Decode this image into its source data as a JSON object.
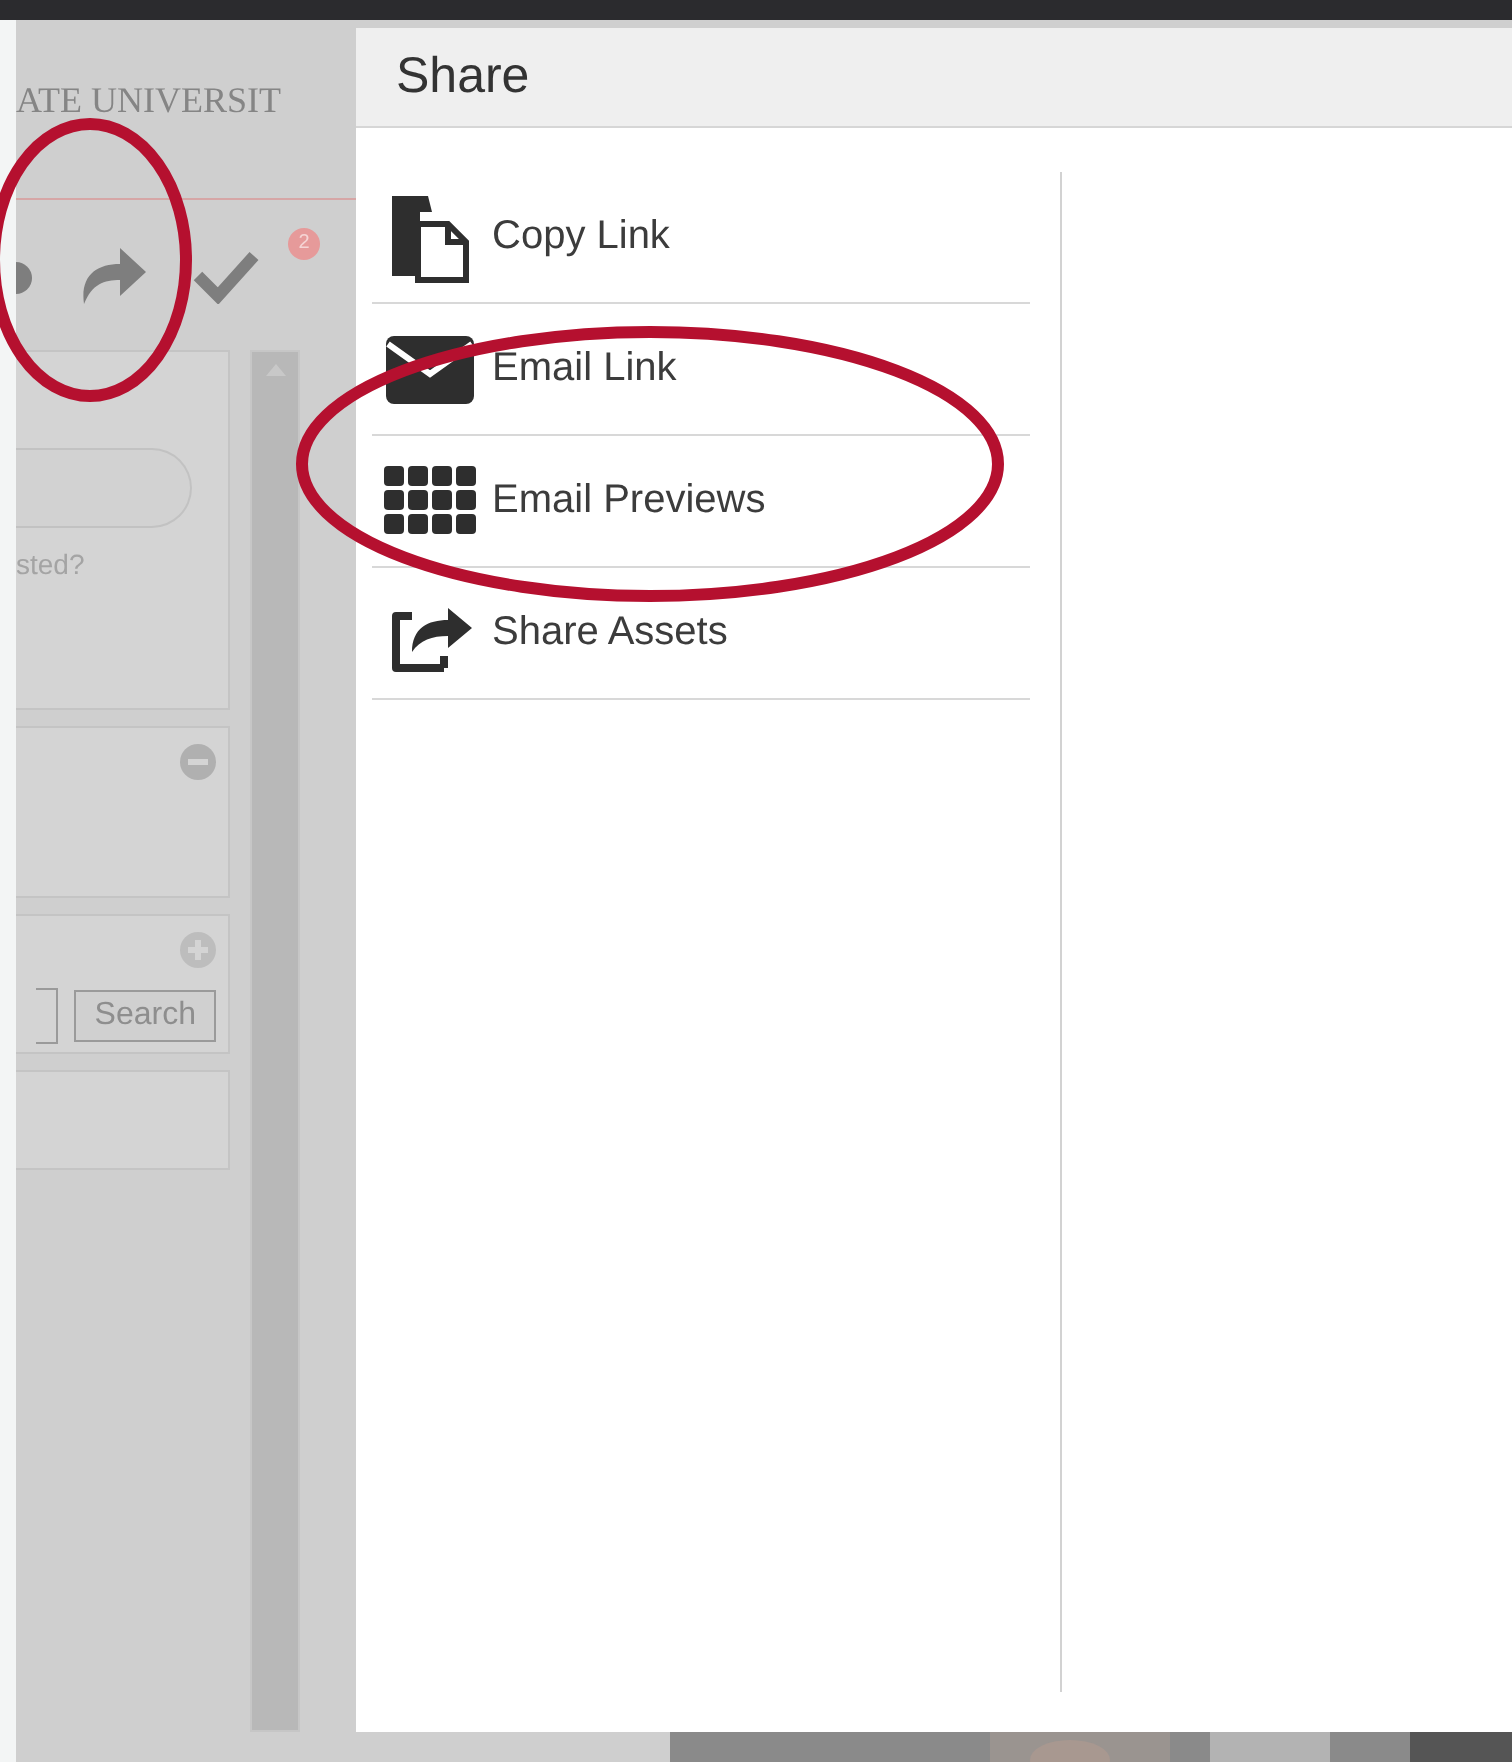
{
  "background": {
    "header_text": "ATE UNIVERSIT",
    "notification_badge": "2",
    "help_text": "sted?",
    "search_button": "Search"
  },
  "dialog": {
    "title": "Share",
    "items": [
      {
        "label": "Copy Link",
        "kind": "copy"
      },
      {
        "label": "Email Link",
        "kind": "email"
      },
      {
        "label": "Email Previews",
        "kind": "grid"
      },
      {
        "label": "Share Assets",
        "kind": "share"
      }
    ]
  }
}
